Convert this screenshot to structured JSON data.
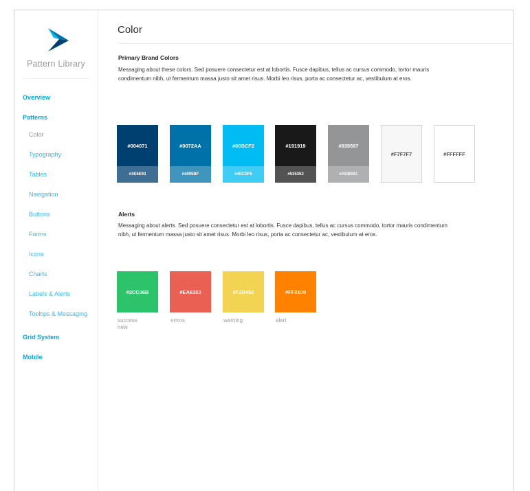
{
  "sidebar": {
    "brand": "Pattern Library",
    "items": {
      "overview": "Overview",
      "patterns": "Patterns",
      "color": "Color",
      "typography": "Typography",
      "tables": "Tables",
      "navigation": "Navigation",
      "buttons": "Buttons",
      "forms": "Forms",
      "icons": "Icons",
      "charts": "Charts",
      "labels_alerts": "Labels & Alerts",
      "tooltips": "Tooltips & Messaging",
      "grid": "Grid System",
      "mobile": "Mobile"
    },
    "accent": "#00A8E0"
  },
  "main": {
    "title": "Color",
    "primary": {
      "heading": "Primary Brand Colors",
      "text": "Messaging about these colors. Sed posuere consectetur est at lobortis. Fusce dapibus, tellus ac cursus commodo, tortor mauris condimentum nibh, ut fermentum massa justo sit amet risus. Morbi leo risus, porta ac consectetur ac, vestibulum at eros.",
      "swatches": [
        {
          "color": "#004071",
          "label": "#004071",
          "tint": "#3E6E93",
          "tint_label": "#3E6E93"
        },
        {
          "color": "#0072AA",
          "label": "#0072AA",
          "tint": "#4095BF",
          "tint_label": "#4095BF"
        },
        {
          "color": "#00BCF2",
          "label": "#00BCF2",
          "tint": "#40CDF5",
          "tint_label": "#40CDF5"
        },
        {
          "color": "#191919",
          "label": "#191919",
          "tint": "#535353",
          "tint_label": "#535353"
        },
        {
          "color": "#939597",
          "label": "#939597",
          "tint": "#AEB0B1",
          "tint_label": "#AEB0B1"
        },
        {
          "color": "#F7F7F7",
          "label": "#F7F7F7"
        },
        {
          "color": "#FFFFFF",
          "label": "#FFFFFF"
        }
      ]
    },
    "alerts": {
      "heading": "Alerts",
      "text": "Messaging about alerts. Sed posuere consectetur est at lobortis. Fusce dapibus, tellus ac cursus commodo, tortor mauris condimentum nibh, ut fermentum massa justo sit amet risus. Morbi leo risus, porta ac consectetur ac, vestibulum at eros.",
      "swatches": [
        {
          "color": "#2CC36B",
          "label": "#2CC36B",
          "caption": "success\nnew"
        },
        {
          "color": "#EA6153",
          "label": "#EA6153",
          "caption": "errors"
        },
        {
          "color": "#F2D452",
          "label": "#F2D452",
          "caption": "warning"
        },
        {
          "color": "#FF8100",
          "label": "#FF8100",
          "caption": "alert"
        }
      ]
    }
  }
}
